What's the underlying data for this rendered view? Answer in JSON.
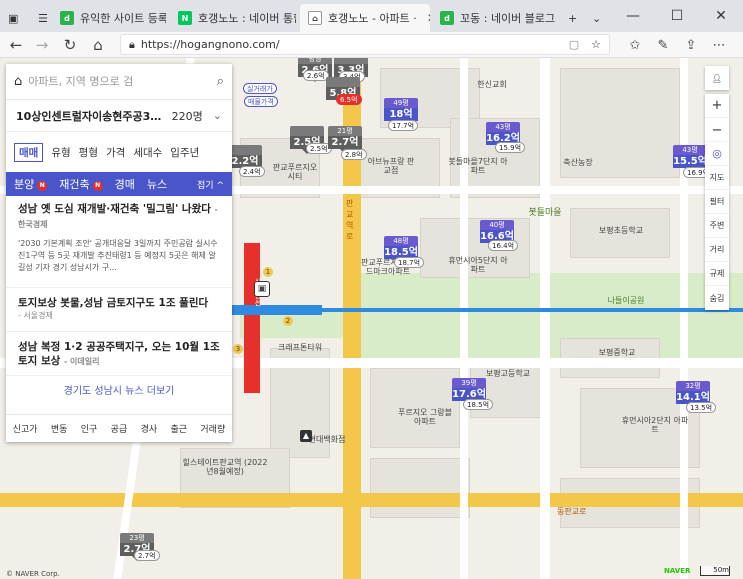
{
  "browser": {
    "tabs": [
      {
        "label": "유익한 사이트 등록 준비",
        "fav": "d"
      },
      {
        "label": "호갱노노 : 네이버 통합",
        "fav": "N"
      },
      {
        "label": "호갱노노 - 아파트 ·",
        "fav": "h"
      },
      {
        "label": "꼬동 : 네이버 블로그",
        "fav": "d"
      }
    ],
    "new_tab": "+",
    "url": "https://hogangnono.com/",
    "controls": {
      "min": "—",
      "max": "☐",
      "close": "✕"
    }
  },
  "panel": {
    "search_placeholder": "아파트, 지역 명으로 검",
    "region": "10상인센트럴자이송현주공3…",
    "count": "220명",
    "filters": [
      "매매",
      "유형",
      "평형",
      "가격",
      "세대수",
      "입주년"
    ],
    "categories": [
      {
        "label": "분양",
        "badge": "N"
      },
      {
        "label": "재건축",
        "badge": "N"
      },
      {
        "label": "경매"
      },
      {
        "label": "뉴스"
      }
    ],
    "collapse": "접기 ^",
    "news": [
      {
        "title": "성남 옛 도심 재개발·재건축 '밀그림' 나왔다",
        "source": "- 한국경제",
        "desc": "'2030 기본계획 조안' 공개대응달 3일까지 주민공람 실시수진1구역 등 5곳 재개발 추진태령1 등 예정지 5곳은 해제 알길성 기자 경기 성남시가 구..."
      },
      {
        "title": "토지보상 봇물,성남 금토지구도 1조 풀린다",
        "source": "- 서울경제"
      },
      {
        "title": "성남 복정 1·2 공공주택지구, 오는 10월 1조 토지 보상",
        "source": "- 이데일리"
      }
    ],
    "more": "경기도 성남시 뉴스 더보기",
    "bottom_tabs": [
      "신고가",
      "변동",
      "인구",
      "공급",
      "경사",
      "출근",
      "거래량"
    ]
  },
  "map": {
    "markers": [
      {
        "area": "평형",
        "price": "2.6억",
        "sub": "2.6억"
      },
      {
        "area": "",
        "price": "3.3억",
        "sub": "3.4억"
      },
      {
        "area": "",
        "price": "5.8억",
        "sub": "6.5억",
        "sub_red": true
      },
      {
        "area": "49평",
        "price": "18억",
        "sub": "17.7억"
      },
      {
        "area": "",
        "price": "2.5억",
        "sub": "2.5억"
      },
      {
        "area": "21평",
        "price": "2.7억",
        "sub": "2.8억"
      },
      {
        "area": "",
        "price": "2.2억",
        "sub": "2.4억"
      },
      {
        "area": "43평",
        "price": "16.2억",
        "sub": "15.9억"
      },
      {
        "area": "43평",
        "price": "15.5억",
        "sub": "16.9억"
      },
      {
        "area": "40평",
        "price": "16.6억",
        "sub": "16.4억"
      },
      {
        "area": "48평",
        "price": "18.5억",
        "sub": "18.7억"
      },
      {
        "area": "39평",
        "price": "17.6억",
        "sub": "18.5억"
      },
      {
        "area": "32평",
        "price": "14.1억",
        "sub": "13.5억"
      },
      {
        "area": "23평",
        "price": "2.7억",
        "sub": "2.7억"
      }
    ],
    "labels": {
      "hanshin": "한신교회",
      "bonggok": "봇들마을",
      "bonggok7": "봇들마을7단지 아파트",
      "abenew": "아브뉴프랑 판교점",
      "bojeong": "보평초등학교",
      "hwedong": "휴먼시아5단지 아파트",
      "hwedong2": "휴먼시아2단지 아파트",
      "naru": "나들이공원",
      "bojeong_mid": "보평중학교",
      "bojeong_high": "보평고등학교",
      "pungbu": "푸르지오 그랑블아파트",
      "bojeong_hs": "보평고등학교",
      "hyundai": "현대백화점",
      "hillstate": "힐스테이트판교역 (2022년8월예정)",
      "crafton": "크래프톤타워",
      "pangyo_tower": "판교푸르지오시티",
      "ryu": "판교역로",
      "dongpangyo": "동판교로",
      "shukr": "축산농장",
      "bonggok_center": "판교푸르지오 월드마크아파트",
      "gangnam_line": "신분당선",
      "naverbutton": "NAVER",
      "copy": "© NAVER Corp.",
      "scale": "50m",
      "chip_label": "매물가격",
      "chip_label2": "실거래가"
    },
    "tools": [
      "지도",
      "필터",
      "주변",
      "거리",
      "규제",
      "숨김"
    ]
  }
}
